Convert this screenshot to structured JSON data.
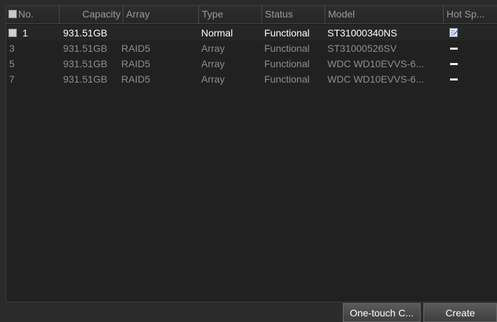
{
  "table": {
    "columns": [
      "No.",
      "Capacity",
      "Array",
      "Type",
      "Status",
      "Model",
      "Hot Sp..."
    ],
    "rows": [
      {
        "no": "1",
        "capacity": "931.51GB",
        "array": "",
        "type": "Normal",
        "status": "Functional",
        "model": "ST31000340NS",
        "hot_spare_icon": "edit-icon",
        "checkbox": true,
        "active": true
      },
      {
        "no": "3",
        "capacity": "931.51GB",
        "array": "RAID5",
        "type": "Array",
        "status": "Functional",
        "model": "ST31000526SV",
        "hot_spare_icon": "dash-icon",
        "checkbox": false,
        "active": false
      },
      {
        "no": "5",
        "capacity": "931.51GB",
        "array": "RAID5",
        "type": "Array",
        "status": "Functional",
        "model": "WDC WD10EVVS-6...",
        "hot_spare_icon": "dash-icon",
        "checkbox": false,
        "active": false
      },
      {
        "no": "7",
        "capacity": "931.51GB",
        "array": "RAID5",
        "type": "Array",
        "status": "Functional",
        "model": "WDC WD10EVVS-6...",
        "hot_spare_icon": "dash-icon",
        "checkbox": false,
        "active": false
      }
    ]
  },
  "buttons": {
    "one_touch_label": "One-touch C...",
    "create_label": "Create"
  },
  "colors": {
    "background": "#2b2b2b",
    "table_background": "#212121",
    "active_text": "#ffffff",
    "inactive_text": "#8e8e8e",
    "header_text": "#9a9a9a"
  }
}
